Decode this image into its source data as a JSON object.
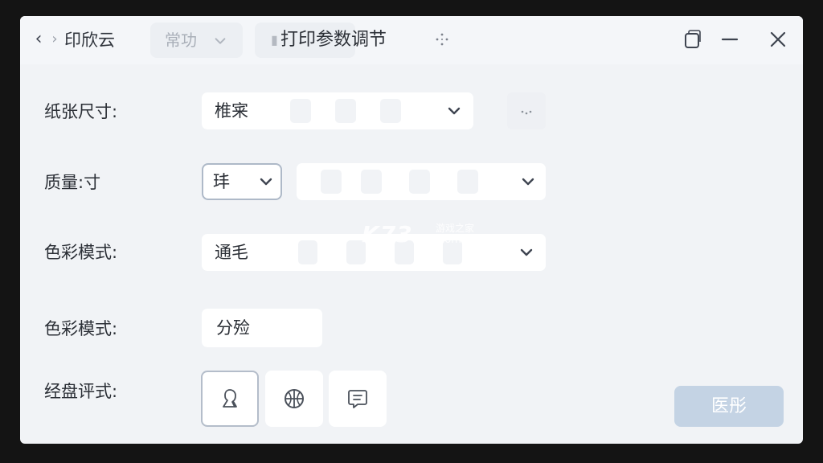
{
  "titlebar": {
    "app_title": "印欣云",
    "mode_value": "常功",
    "page_title": "打印参数调节"
  },
  "form": {
    "paper_size": {
      "label": "纸张尺寸:",
      "value": "椎宷"
    },
    "quality": {
      "label": "质量:寸",
      "value": "玤"
    },
    "color_mode": {
      "label": "色彩模式:",
      "value": "通毛"
    },
    "color_mode_2": {
      "label": "色彩模式:",
      "value": "分殓"
    },
    "layout_style": {
      "label": "经盘评式:",
      "options": [
        {
          "icon": "person-icon",
          "selected": true
        },
        {
          "icon": "basketball-icon",
          "selected": false
        },
        {
          "icon": "message-icon",
          "selected": false
        }
      ]
    }
  },
  "actions": {
    "confirm_label": "医彤"
  },
  "watermark": {
    "brand": "K73",
    "tagline": "游戏之家",
    "domain": ".com"
  },
  "colors": {
    "accent": "#c4d3e4",
    "background": "#f1f3f6",
    "field": "#ffffff"
  }
}
